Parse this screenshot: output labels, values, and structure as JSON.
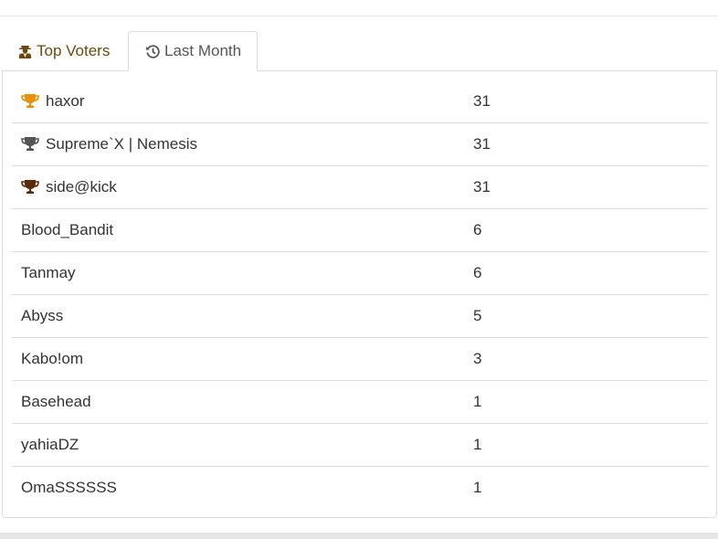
{
  "tabs": [
    {
      "label": "Top Voters",
      "icon": "user-secret-icon",
      "active": false
    },
    {
      "label": "Last Month",
      "icon": "history-icon",
      "active": true
    }
  ],
  "rows": [
    {
      "name": "haxor",
      "votes": "31",
      "trophy": "gold"
    },
    {
      "name": "Supreme`X | Nemesis",
      "votes": "31",
      "trophy": "silver"
    },
    {
      "name": "side@kick",
      "votes": "31",
      "trophy": "bronze"
    },
    {
      "name": "Blood_Bandit",
      "votes": "6"
    },
    {
      "name": "Tanmay",
      "votes": "6"
    },
    {
      "name": "Abyss",
      "votes": "5"
    },
    {
      "name": "Kabo!om",
      "votes": "3"
    },
    {
      "name": "Basehead",
      "votes": "1"
    },
    {
      "name": "yahiaDZ",
      "votes": "1"
    },
    {
      "name": "OmaSSSSSS",
      "votes": "1"
    }
  ],
  "colors": {
    "gold": "#e8920a",
    "silver": "#555555",
    "bronze": "#5a2a0a",
    "tab_active_text": "#555555",
    "tab_inactive_text": "#6a4a0c"
  }
}
